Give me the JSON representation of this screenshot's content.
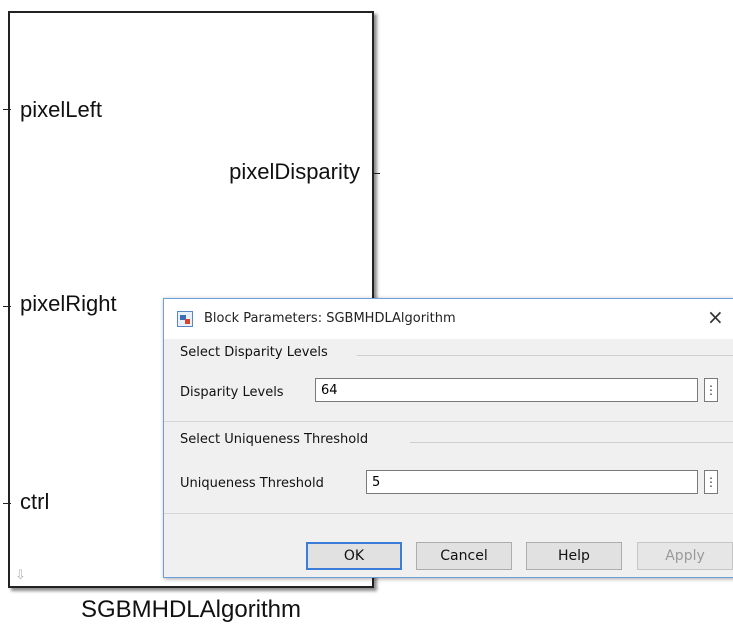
{
  "block": {
    "name": "SGBMHDLAlgorithm",
    "inputs": [
      "pixelLeft",
      "pixelRight",
      "ctrl"
    ],
    "outputs": [
      "pixelDisparity"
    ]
  },
  "dialog": {
    "title": "Block Parameters: SGBMHDLAlgorithm",
    "close_label": "×",
    "groups": [
      {
        "title": "Select Disparity Levels",
        "field_label": "Disparity Levels",
        "value": "64"
      },
      {
        "title": "Select Uniqueness Threshold",
        "field_label": "Uniqueness Threshold",
        "value": "5"
      }
    ],
    "buttons": {
      "ok": "OK",
      "cancel": "Cancel",
      "help": "Help",
      "apply": "Apply"
    },
    "kebab_glyph": "⋮"
  },
  "icons": {
    "dialog_icon": "simulink-block-icon",
    "resize": "arrow-down-icon"
  },
  "colors": {
    "dialog_border": "#6f9fd8",
    "default_button_border": "#3b7dd8"
  }
}
